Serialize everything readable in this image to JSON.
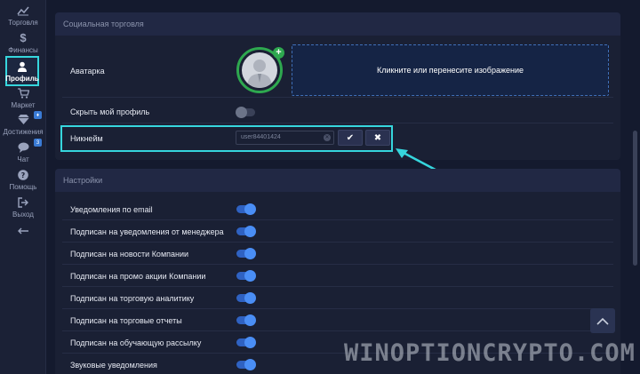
{
  "sidebar": {
    "items": [
      {
        "label": "Торговля",
        "icon": "chart-line-icon"
      },
      {
        "label": "Финансы",
        "icon": "dollar-icon"
      },
      {
        "label": "Профиль",
        "icon": "user-icon",
        "active": true
      },
      {
        "label": "Маркет",
        "icon": "cart-icon"
      },
      {
        "label": "Достижения",
        "icon": "diamond-icon",
        "badge": "♦"
      },
      {
        "label": "Чат",
        "icon": "chat-icon",
        "badge": "3"
      },
      {
        "label": "Помощь",
        "icon": "help-icon"
      },
      {
        "label": "Выход",
        "icon": "logout-icon"
      }
    ]
  },
  "social": {
    "title": "Социальная торговля",
    "avatar_label": "Аватарка",
    "dropzone_text": "Кликните или перенесите изображение",
    "hide_profile_label": "Скрыть мой профиль",
    "hide_profile_on": false,
    "nickname_label": "Никнейм",
    "nickname_value": "user84401424",
    "confirm_symbol": "✔",
    "cancel_symbol": "✖"
  },
  "settings": {
    "title": "Настройки",
    "items": [
      {
        "label": "Уведомления по email",
        "on": true
      },
      {
        "label": "Подписан на уведомления от менеджера",
        "on": true
      },
      {
        "label": "Подписан на новости Компании",
        "on": true
      },
      {
        "label": "Подписан на промо акции Компании",
        "on": true
      },
      {
        "label": "Подписан на торговую аналитику",
        "on": true
      },
      {
        "label": "Подписан на торговые отчеты",
        "on": true
      },
      {
        "label": "Подписан на обучающую рассылку",
        "on": true
      },
      {
        "label": "Звуковые уведомления",
        "on": true
      }
    ]
  },
  "watermark": "WINOPTIONCRYPTO.COM",
  "colors": {
    "accent_highlight": "#36d6dd",
    "toggle_on": "#4a8ef5",
    "avatar_ring": "#2ea84f",
    "background": "#141a2e"
  }
}
